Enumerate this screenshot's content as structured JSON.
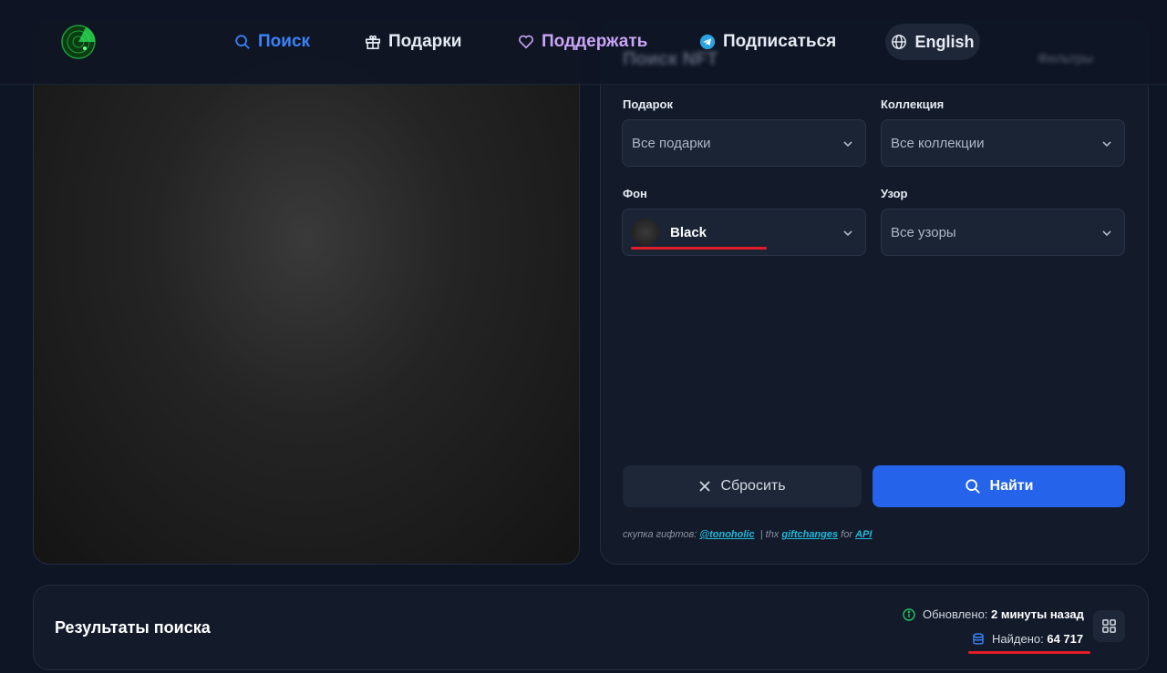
{
  "nav": {
    "search_label": "Поиск",
    "gifts_label": "Подарки",
    "donate_label": "Поддержать",
    "subscribe_label": "Подписаться",
    "language_label": "English"
  },
  "filter_panel": {
    "title": "Поиск NFT",
    "filters_label": "Фильтры",
    "gift": {
      "label": "Подарок",
      "value": "Все подарки"
    },
    "collection": {
      "label": "Коллекция",
      "value": "Все коллекции"
    },
    "background": {
      "label": "Фон",
      "value": "Black"
    },
    "pattern": {
      "label": "Узор",
      "value": "Все узоры"
    },
    "reset_label": "Сбросить",
    "find_label": "Найти",
    "credits": {
      "prefix": "скупка гифтов:",
      "handle": "@tonoholic",
      "middle": "| thx",
      "partner": "giftchanges",
      "for_text": "for",
      "api": "API"
    }
  },
  "results": {
    "title": "Результаты поиска",
    "updated_label": "Обновлено:",
    "updated_value": "2 минуты назад",
    "found_label": "Найдено:",
    "found_value": "64 717"
  },
  "colors": {
    "accent_blue": "#2563eb",
    "nav_active": "#3b82f6",
    "donate_purple": "#c9a5f5",
    "annotation_red": "#e11d2a",
    "panel_bg": "#131b2b",
    "page_bg": "#0e1524"
  },
  "icons": {
    "logo": "radar-logo",
    "search": "search-icon",
    "gift": "gift-icon",
    "heart": "heart-icon",
    "telegram": "telegram-icon",
    "globe": "globe-icon",
    "chevron": "chevron-down-icon",
    "close": "close-icon",
    "info": "info-icon",
    "database": "database-icon",
    "grid": "grid-icon"
  }
}
